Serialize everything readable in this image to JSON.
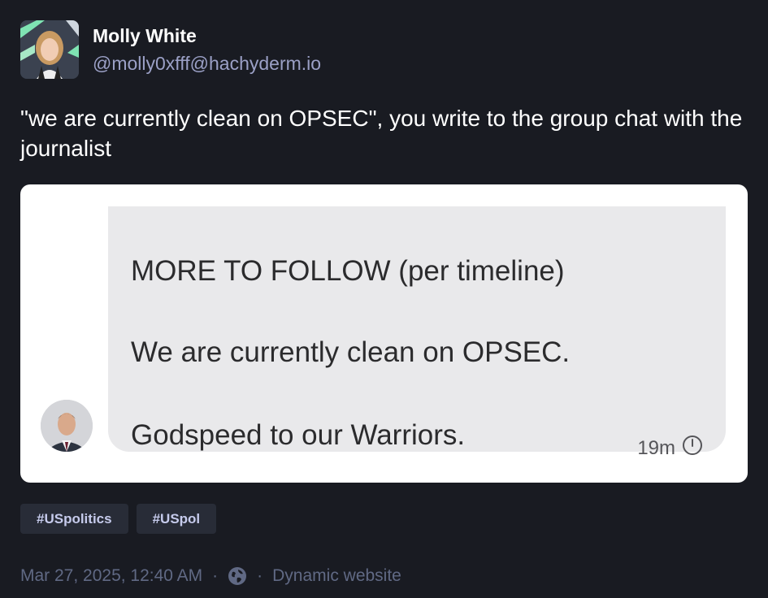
{
  "author": {
    "display_name": "Molly White",
    "handle": "@molly0xfff@hachyderm.io",
    "avatar_icon": "profile-photo"
  },
  "status": {
    "text": "\"we are currently clean on OPSEC\", you write to the group chat with the journalist"
  },
  "media": {
    "sender_avatar_icon": "sender-photo",
    "messages": [
      "MORE TO FOLLOW (per timeline)",
      "We are currently clean on OPSEC.",
      "Godspeed to our Warriors."
    ],
    "timestamp": "19m",
    "timestamp_icon": "clock-icon"
  },
  "hashtags": [
    "#USpolitics",
    "#USpol"
  ],
  "meta": {
    "date": "Mar 27, 2025, 12:40 AM",
    "separator": "·",
    "visibility_icon": "globe-icon",
    "source": "Dynamic website"
  },
  "colors": {
    "background": "#191b22",
    "handle": "#9ba0c6",
    "hashtag_bg": "#282c37",
    "hashtag_text": "#c6cbec",
    "meta": "#606984",
    "bubble": "#e9e9eb"
  }
}
